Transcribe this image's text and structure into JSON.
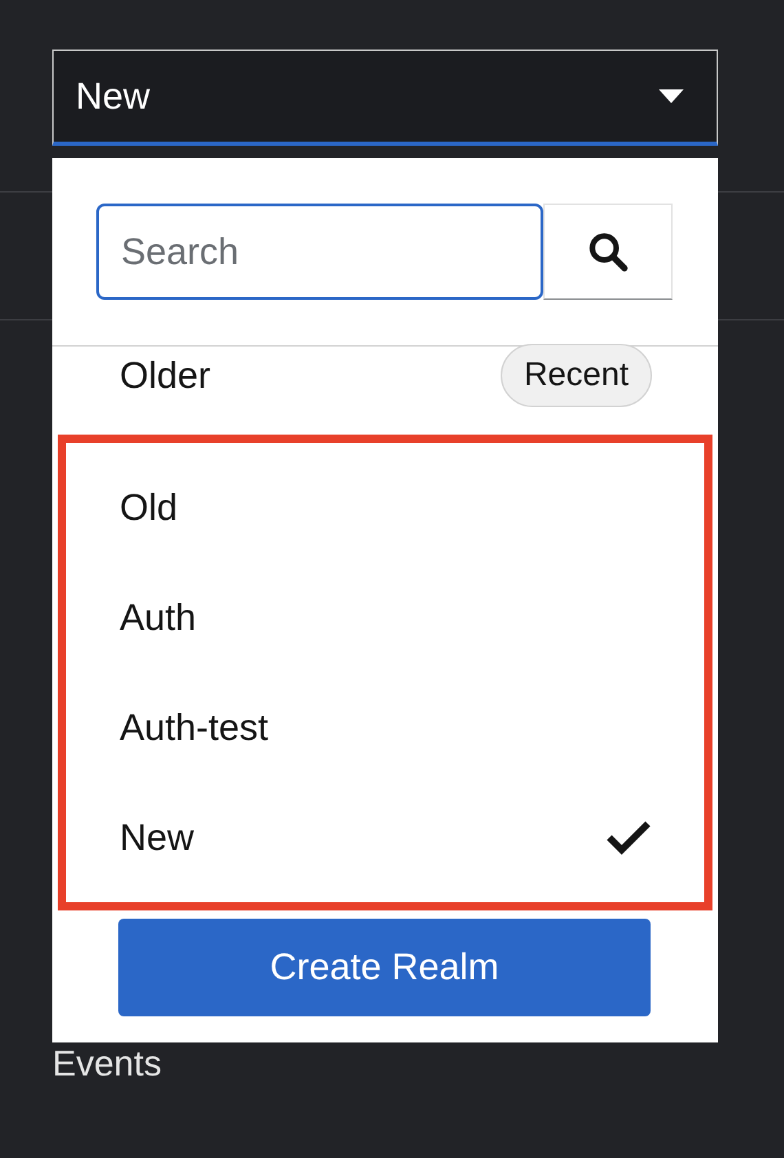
{
  "realm_select": {
    "value": "New",
    "expanded": true
  },
  "menu": {
    "search": {
      "placeholder": "Search"
    },
    "recent": [
      {
        "label": "Older",
        "badge": "Recent"
      }
    ],
    "realms_highlighted": true,
    "realms": [
      {
        "label": "Old",
        "selected": false
      },
      {
        "label": "Auth",
        "selected": false
      },
      {
        "label": "Auth-test",
        "selected": false
      },
      {
        "label": "New",
        "selected": true
      }
    ],
    "create_button": "Create Realm"
  },
  "nav": [
    {
      "label": "Events"
    }
  ]
}
